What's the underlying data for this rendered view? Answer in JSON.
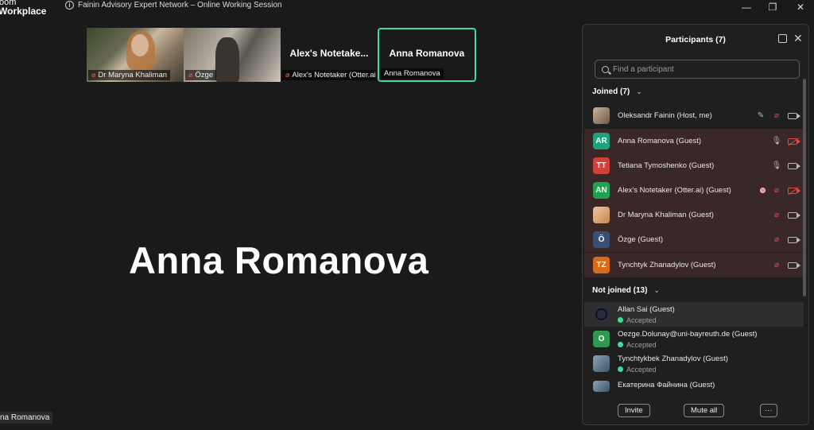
{
  "app": {
    "logo_line1": "oom",
    "logo_line2": "Workplace"
  },
  "window": {
    "title": "Fainin Advisory Expert Network – Online Working Session",
    "minimize": "—",
    "restore": "❐",
    "close": "✕"
  },
  "strip": {
    "tiles": [
      {
        "label": "Dr Maryna Khaliman",
        "muted": true
      },
      {
        "label": "Özge",
        "muted": true
      },
      {
        "big": "Alex's  Notetake...",
        "label": "Alex's Notetaker (Otter.ai)",
        "muted": true
      },
      {
        "big": "Anna Romanova",
        "label": "Anna Romanova",
        "muted": false
      }
    ]
  },
  "main": {
    "speaker": "Anna Romanova",
    "bottom_label": "na Romanova"
  },
  "panel": {
    "title": "Participants (7)",
    "search_placeholder": "Find a participant",
    "joined_header": "Joined (7)",
    "not_joined_header": "Not joined (13)",
    "joined": [
      {
        "name": "Oleksandr Fainin (Host, me)",
        "initials": ""
      },
      {
        "name": "Anna Romanova (Guest)",
        "initials": "AR",
        "color": "#1fa37c"
      },
      {
        "name": "Tetiana Tymoshenko (Guest)",
        "initials": "TT",
        "color": "#d0413b"
      },
      {
        "name": "Alex's Notetaker (Otter.ai) (Guest)",
        "initials": "AN",
        "color": "#1fa351"
      },
      {
        "name": "Dr Maryna Khaliman (Guest)",
        "initials": ""
      },
      {
        "name": "Özge (Guest)",
        "initials": "Ö",
        "color": "#3b4f73"
      },
      {
        "name": "Tynchtyk Zhanadylov (Guest)",
        "initials": "TZ",
        "color": "#d96a1a"
      }
    ],
    "not_joined": [
      {
        "name": "Allan Sai (Guest)",
        "status": "Accepted"
      },
      {
        "name": "Oezge.Dolunay@uni-bayreuth.de (Guest)",
        "initials": "O",
        "color": "#2f9a4f",
        "status": "Accepted"
      },
      {
        "name": "Tynchtykbek Zhanadylov (Guest)",
        "status": "Accepted"
      },
      {
        "name": "Екатерина Файнина (Guest)"
      }
    ],
    "invite_label": "Invite",
    "mute_all_label": "Mute all",
    "more_label": "···"
  }
}
